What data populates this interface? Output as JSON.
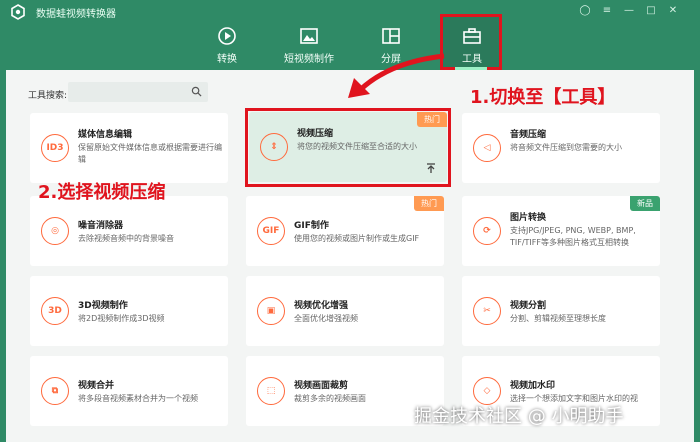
{
  "app": {
    "title": "数据蛙视频转换器"
  },
  "nav": {
    "items": [
      {
        "label": "转换",
        "icon": "convert-icon"
      },
      {
        "label": "短视频制作",
        "icon": "image-icon"
      },
      {
        "label": "分屏",
        "icon": "split-screen-icon"
      },
      {
        "label": "工具",
        "icon": "toolbox-icon"
      }
    ],
    "active": "工具"
  },
  "search": {
    "label": "工具搜索:",
    "placeholder": "",
    "value": ""
  },
  "cards": [
    {
      "title": "媒体信息编辑",
      "desc": "保留原始文件媒体信息或根据需要进行编辑",
      "icon_text": "ID3",
      "badge": ""
    },
    {
      "title": "视频压缩",
      "desc": "将您的视频文件压缩至合适的大小",
      "icon_text": "⇕",
      "badge": "热门"
    },
    {
      "title": "音频压缩",
      "desc": "将音频文件压缩到您需要的大小",
      "icon_text": "◁",
      "badge": ""
    },
    {
      "title": "噪音消除器",
      "desc": "去除视频音频中的背景噪音",
      "icon_text": "◎",
      "badge": ""
    },
    {
      "title": "GIF制作",
      "desc": "使用您的视频或图片制作或生成GIF",
      "icon_text": "GIF",
      "badge": "热门"
    },
    {
      "title": "图片转换",
      "desc": "支持JPG/JPEG, PNG, WEBP, BMP, TIF/TIFF等多种图片格式互相转换",
      "icon_text": "⟳",
      "badge": "新品"
    },
    {
      "title": "3D视频制作",
      "desc": "将2D视频制作成3D视频",
      "icon_text": "3D",
      "badge": ""
    },
    {
      "title": "视频优化增强",
      "desc": "全面优化增强视频",
      "icon_text": "▣",
      "badge": ""
    },
    {
      "title": "视频分割",
      "desc": "分割、剪辑视频至理想长度",
      "icon_text": "✂",
      "badge": ""
    },
    {
      "title": "视频合并",
      "desc": "将多段音视频素材合并为一个视频",
      "icon_text": "⧉",
      "badge": ""
    },
    {
      "title": "视频画面裁剪",
      "desc": "裁剪多余的视频画面",
      "icon_text": "⬚",
      "badge": ""
    },
    {
      "title": "视频加水印",
      "desc": "选择一个想添加文字和图片水印的视",
      "icon_text": "◇",
      "badge": ""
    }
  ],
  "annotations": {
    "step1": "1.切换至【工具】",
    "step2": "2.选择视频压缩"
  },
  "watermark": "掘金技术社区 @ 小明助手",
  "colors": {
    "brand": "#2f8a66",
    "accent": "#ff6a3d",
    "annotation": "#e0141e",
    "hot": "#ff9a52",
    "new": "#3aa26f"
  }
}
